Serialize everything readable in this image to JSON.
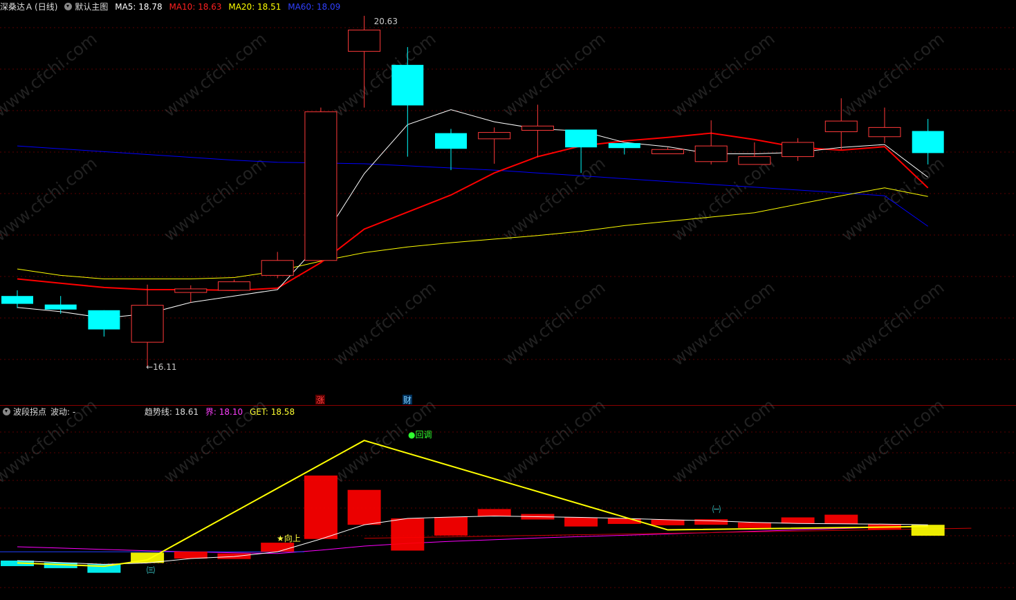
{
  "header": {
    "stock_name": "深桑达Ａ",
    "period": "(日线)",
    "main_chart_label": "默认主图",
    "ma5": "MA5: 18.78",
    "ma10": "MA10: 18.63",
    "ma20": "MA20: 18.51",
    "ma60": "MA60: 18.09"
  },
  "colors": {
    "up": "#ff3a3a",
    "down": "#00ffff",
    "ma5": "#ffffff",
    "ma10": "#ff0000",
    "ma20": "#ffff00",
    "ma60": "#0000ff",
    "grid": "#5a0000",
    "purple": "#ff00ff"
  },
  "markers": {
    "high_label": "20.63",
    "low_label": "←16.11",
    "rise_tag": "涨",
    "fin_tag": "财"
  },
  "sub_header": {
    "indicator_name": "波段拐点",
    "wave": "波动: -",
    "trend": "趋势线: 18.61",
    "bound": "界: 18.10",
    "get": "GET: 18.58"
  },
  "sub_labels": {
    "pullback": "●回调",
    "upward": "★向上",
    "wave3": "㈢",
    "wave1": "㈠"
  },
  "watermark": "www.cfchi.com",
  "chart_data": [
    {
      "type": "candlestick",
      "title": "",
      "ylim": [
        15.8,
        21.0
      ],
      "x": [
        1,
        2,
        3,
        4,
        5,
        6,
        7,
        8,
        9,
        10,
        11,
        12,
        13,
        14,
        15,
        16,
        17,
        18,
        19,
        20,
        21,
        22
      ],
      "open": [
        17.11,
        16.99,
        16.91,
        16.46,
        17.16,
        17.19,
        17.4,
        17.61,
        20.55,
        20.36,
        19.4,
        19.32,
        19.44,
        19.45,
        19.26,
        19.11,
        19.0,
        18.96,
        19.07,
        19.42,
        19.35,
        19.43
      ],
      "close": [
        17.0,
        16.92,
        16.64,
        16.98,
        17.21,
        17.31,
        17.61,
        19.7,
        20.85,
        19.79,
        19.18,
        19.41,
        19.5,
        19.2,
        19.19,
        19.17,
        19.22,
        19.07,
        19.27,
        19.57,
        19.48,
        19.12
      ],
      "high": [
        17.19,
        17.11,
        16.91,
        17.27,
        17.26,
        17.34,
        17.73,
        19.76,
        21.05,
        20.61,
        19.46,
        19.48,
        19.8,
        19.43,
        19.26,
        19.2,
        19.58,
        19.27,
        19.33,
        19.89,
        19.76,
        19.6
      ],
      "low": [
        16.94,
        16.86,
        16.54,
        16.11,
        17.02,
        17.23,
        17.36,
        17.59,
        19.76,
        19.07,
        18.88,
        18.97,
        19.06,
        18.84,
        19.1,
        19.13,
        18.96,
        18.96,
        19.01,
        19.17,
        19.26,
        18.96
      ],
      "ma5": [
        16.95,
        16.89,
        16.8,
        16.86,
        17.02,
        17.11,
        17.2,
        17.87,
        18.83,
        19.52,
        19.73,
        19.56,
        19.46,
        19.43,
        19.27,
        19.21,
        19.11,
        19.11,
        19.13,
        19.2,
        19.24,
        18.78
      ],
      "ma10": [
        17.35,
        17.29,
        17.23,
        17.2,
        17.2,
        17.19,
        17.22,
        17.58,
        18.05,
        18.29,
        18.53,
        18.84,
        19.07,
        19.22,
        19.29,
        19.34,
        19.4,
        19.31,
        19.2,
        19.16,
        19.21,
        18.63
      ],
      "ma20": [
        17.49,
        17.4,
        17.35,
        17.35,
        17.35,
        17.37,
        17.46,
        17.6,
        17.72,
        17.8,
        17.86,
        17.91,
        17.96,
        18.02,
        18.1,
        18.16,
        18.22,
        18.28,
        18.4,
        18.52,
        18.63,
        18.51
      ],
      "ma60": [
        19.22,
        19.18,
        19.14,
        19.1,
        19.06,
        19.02,
        18.99,
        18.98,
        18.97,
        18.94,
        18.91,
        18.88,
        18.84,
        18.8,
        18.76,
        18.72,
        18.68,
        18.64,
        18.6,
        18.56,
        18.52,
        18.09
      ]
    },
    {
      "type": "indicator",
      "title": "",
      "x": [
        1,
        2,
        3,
        4,
        5,
        6,
        7,
        8,
        9,
        10,
        11,
        12,
        13,
        14,
        15,
        16,
        17,
        18,
        19,
        20,
        21,
        22
      ],
      "zigzag_points": [
        [
          1,
          16.92
        ],
        [
          3,
          16.82
        ],
        [
          4,
          17.01
        ],
        [
          9,
          20.55
        ],
        [
          16,
          17.9
        ],
        [
          22,
          18.0
        ]
      ],
      "trend": [
        16.99,
        16.93,
        16.88,
        16.92,
        17.05,
        17.11,
        17.25,
        17.63,
        18.05,
        18.24,
        18.28,
        18.31,
        18.29,
        18.27,
        18.24,
        18.2,
        18.17,
        18.12,
        18.09,
        18.08,
        18.07,
        18.05
      ],
      "bound": [
        17.4,
        17.36,
        17.32,
        17.28,
        17.25,
        17.22,
        17.2,
        17.3,
        17.42,
        17.5,
        17.56,
        17.61,
        17.66,
        17.7,
        17.74,
        17.78,
        17.82,
        17.86,
        17.9,
        17.94,
        17.98,
        18.02
      ]
    }
  ]
}
